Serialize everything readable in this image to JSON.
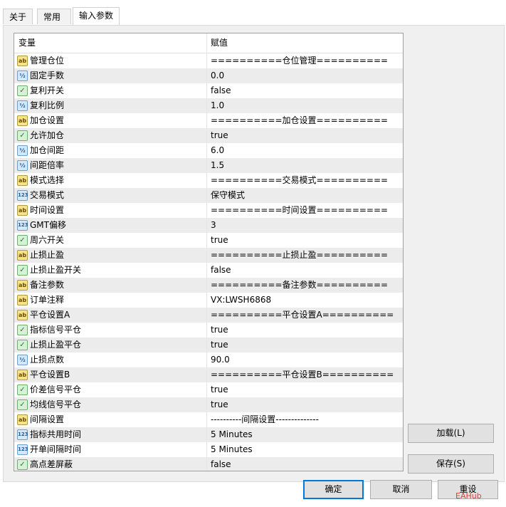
{
  "tabs": [
    "关于",
    "常用",
    "输入参数"
  ],
  "table": {
    "col_name": "变量",
    "col_value": "赋值"
  },
  "rows": [
    {
      "icon": "ab",
      "name": "管理仓位",
      "value": "==========仓位管理=========="
    },
    {
      "icon": "num",
      "name": "固定手数",
      "value": "0.0"
    },
    {
      "icon": "bool",
      "name": "复利开关",
      "value": "false"
    },
    {
      "icon": "num",
      "name": "复利比例",
      "value": "1.0"
    },
    {
      "icon": "ab",
      "name": "加仓设置",
      "value": "==========加仓设置=========="
    },
    {
      "icon": "bool",
      "name": "允许加仓",
      "value": "true"
    },
    {
      "icon": "num",
      "name": "加仓间距",
      "value": "6.0"
    },
    {
      "icon": "num",
      "name": "间距倍率",
      "value": "1.5"
    },
    {
      "icon": "ab",
      "name": "模式选择",
      "value": "==========交易模式=========="
    },
    {
      "icon": "n123",
      "name": "交易模式",
      "value": "保守模式"
    },
    {
      "icon": "ab",
      "name": "时间设置",
      "value": "==========时间设置=========="
    },
    {
      "icon": "n123",
      "name": "GMT偏移",
      "value": "3"
    },
    {
      "icon": "bool",
      "name": "周六开关",
      "value": "true"
    },
    {
      "icon": "ab",
      "name": "止损止盈",
      "value": "==========止损止盈=========="
    },
    {
      "icon": "bool",
      "name": "止损止盈开关",
      "value": "false"
    },
    {
      "icon": "ab",
      "name": "备注参数",
      "value": "==========备注参数=========="
    },
    {
      "icon": "ab",
      "name": "订单注释",
      "value": "VX:LWSH6868"
    },
    {
      "icon": "ab",
      "name": "平仓设置A",
      "value": "==========平仓设置A=========="
    },
    {
      "icon": "bool",
      "name": "指标信号平仓",
      "value": "true"
    },
    {
      "icon": "bool",
      "name": "止损止盈平仓",
      "value": "true"
    },
    {
      "icon": "num",
      "name": "止损点数",
      "value": "90.0"
    },
    {
      "icon": "ab",
      "name": "平仓设置B",
      "value": "==========平仓设置B=========="
    },
    {
      "icon": "bool",
      "name": "价差信号平仓",
      "value": "true"
    },
    {
      "icon": "bool",
      "name": "均线信号平仓",
      "value": "true"
    },
    {
      "icon": "ab",
      "name": "间隔设置",
      "value": "----------间隔设置--------------"
    },
    {
      "icon": "n123",
      "name": "指标共用时间",
      "value": "5 Minutes"
    },
    {
      "icon": "n123",
      "name": "开单间隔时间",
      "value": "5 Minutes"
    },
    {
      "icon": "bool",
      "name": "高点差屏蔽",
      "value": "false"
    }
  ],
  "icons": {
    "ab": "ab",
    "num": "½",
    "n123": "123",
    "bool": "✓"
  },
  "buttons": {
    "load": "加载(L)",
    "save": "保存(S)",
    "ok": "确定",
    "cancel": "取消",
    "reset": "重设"
  },
  "watermark": "EAHub"
}
